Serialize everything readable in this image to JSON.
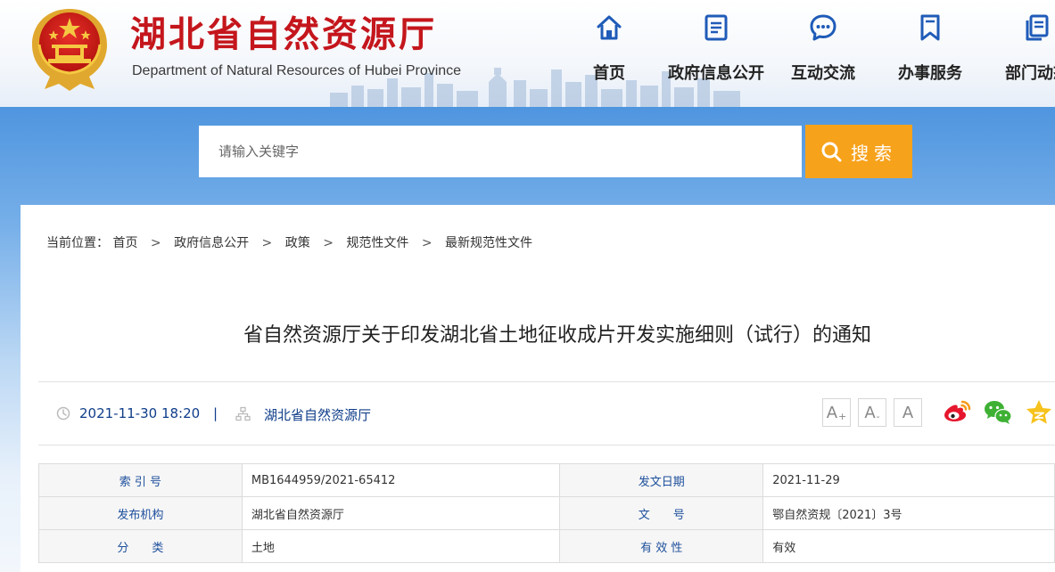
{
  "header": {
    "site_title": "湖北省自然资源厅",
    "site_subtitle": "Department of Natural Resources of Hubei Province"
  },
  "nav": {
    "items": [
      {
        "label": "首页",
        "icon": "home-icon"
      },
      {
        "label": "政府信息公开",
        "icon": "document-icon"
      },
      {
        "label": "互动交流",
        "icon": "chat-bubble-icon"
      },
      {
        "label": "办事服务",
        "icon": "bookmark-icon"
      },
      {
        "label": "部门动态",
        "icon": "files-icon"
      }
    ]
  },
  "search": {
    "placeholder": "请输入关键字",
    "button_label": "搜索"
  },
  "breadcrumb": {
    "prefix": "当前位置：",
    "sep": ">",
    "items": [
      "首页",
      "政府信息公开",
      "政策",
      "规范性文件",
      "最新规范性文件"
    ]
  },
  "article": {
    "title": "省自然资源厅关于印发湖北省土地征收成片开发实施细则（试行）的通知",
    "date": "2021-11-30 18:20",
    "divider": "|",
    "source": "湖北省自然资源厅"
  },
  "font_controls": {
    "increase": "A",
    "increase_mark": "+",
    "decrease": "A",
    "decrease_mark": "-",
    "reset": "A"
  },
  "share": [
    "weibo-icon",
    "wechat-icon",
    "favorite-star-icon"
  ],
  "info_table": {
    "rows": [
      {
        "label1": "索 引 号",
        "value1": "MB1644959/2021-65412",
        "label2": "发文日期",
        "value2": "2021-11-29"
      },
      {
        "label1": "发布机构",
        "value1": "湖北省自然资源厅",
        "label2": "文　　号",
        "value2": "鄂自然资规〔2021〕3号"
      },
      {
        "label1": "分　　类",
        "value1": "土地",
        "label2": "有 效 性",
        "value2": "有效"
      }
    ]
  },
  "colors": {
    "brand_red": "#c4161c",
    "search_orange": "#f7a21b",
    "nav_blue": "#1f5bb8",
    "meta_blue": "#0f3d8a"
  }
}
